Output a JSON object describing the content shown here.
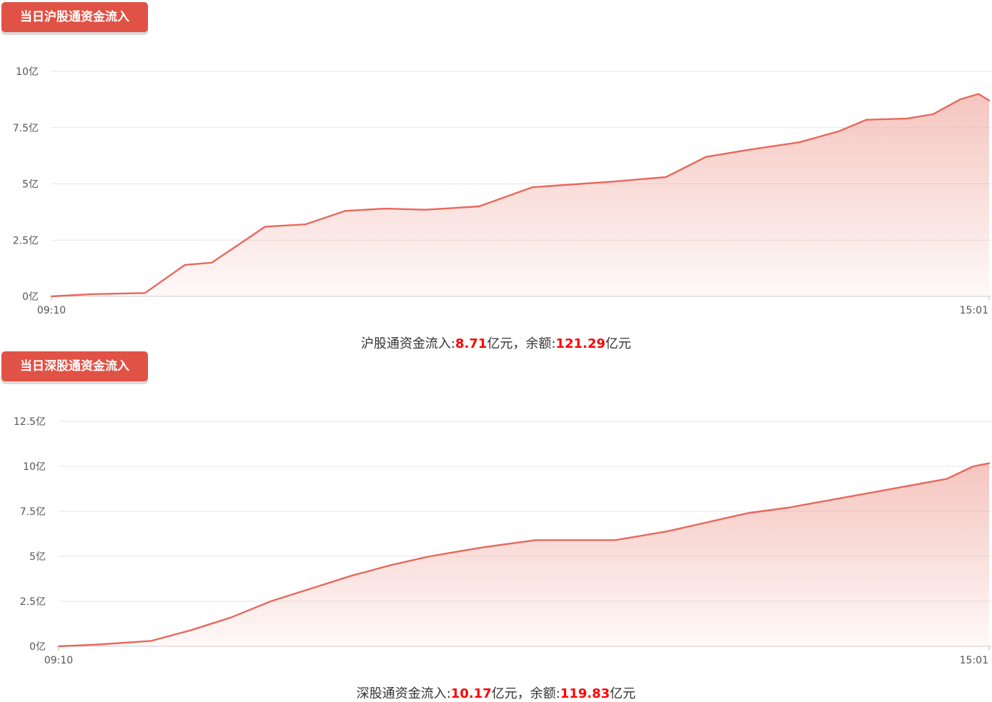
{
  "charts": [
    {
      "badge": "当日沪股通资金流入",
      "summary": {
        "prefix": "沪股通资金流入:",
        "inflow": "8.71",
        "unit1": "亿元，余额:",
        "balance": "121.29",
        "unit2": "亿元"
      }
    },
    {
      "badge": "当日深股通资金流入",
      "summary": {
        "prefix": "深股通资金流入:",
        "inflow": "10.17",
        "unit1": "亿元，余额:",
        "balance": "119.83",
        "unit2": "亿元"
      }
    }
  ],
  "colors": {
    "line": "#e8685c",
    "fill_top": "#f2b2aa",
    "grid": "#e3e3e3",
    "badge": "#e05245",
    "highlight": "#ff0000"
  },
  "chart_data": [
    {
      "type": "area",
      "title": "当日沪股通资金流入",
      "ylim": [
        0,
        10
      ],
      "yticks": [
        0,
        2.5,
        5,
        7.5,
        10
      ],
      "ytick_labels": [
        "0亿",
        "2.5亿",
        "5亿",
        "7.5亿",
        "10亿"
      ],
      "xtick_labels": [
        "09:10",
        "15:01"
      ],
      "x_range": [
        "09:10",
        "15:01"
      ],
      "grid": true,
      "x": [
        "09:10",
        "09:25",
        "09:45",
        "10:00",
        "10:10",
        "10:20",
        "10:30",
        "10:45",
        "11:00",
        "11:15",
        "11:30",
        "11:50",
        "12:10",
        "12:40",
        "13:00",
        "13:15",
        "13:30",
        "13:50",
        "14:05",
        "14:15",
        "14:30",
        "14:40",
        "14:50",
        "14:57",
        "15:01"
      ],
      "values": [
        0.0,
        0.1,
        0.15,
        1.4,
        1.5,
        2.3,
        3.1,
        3.2,
        3.8,
        3.9,
        3.85,
        4.0,
        4.85,
        5.1,
        5.3,
        6.2,
        6.5,
        6.85,
        7.35,
        7.85,
        7.9,
        8.1,
        8.75,
        9.0,
        8.71
      ]
    },
    {
      "type": "area",
      "title": "当日深股通资金流入",
      "ylim": [
        0,
        12.5
      ],
      "yticks": [
        0,
        2.5,
        5,
        7.5,
        10,
        12.5
      ],
      "ytick_labels": [
        "0亿",
        "2.5亿",
        "5亿",
        "7.5亿",
        "10亿",
        "12.5亿"
      ],
      "xtick_labels": [
        "09:10",
        "15:01"
      ],
      "x_range": [
        "09:10",
        "15:01"
      ],
      "grid": true,
      "x": [
        "09:10",
        "09:25",
        "09:45",
        "10:00",
        "10:15",
        "10:30",
        "10:45",
        "11:00",
        "11:15",
        "11:30",
        "11:50",
        "12:10",
        "12:40",
        "13:00",
        "13:15",
        "13:30",
        "13:45",
        "14:00",
        "14:15",
        "14:30",
        "14:45",
        "14:55",
        "15:01"
      ],
      "values": [
        0.0,
        0.1,
        0.3,
        0.9,
        1.6,
        2.5,
        3.2,
        3.9,
        4.5,
        5.0,
        5.5,
        5.9,
        5.9,
        6.4,
        6.9,
        7.4,
        7.7,
        8.1,
        8.5,
        8.9,
        9.3,
        10.0,
        10.17
      ]
    }
  ]
}
